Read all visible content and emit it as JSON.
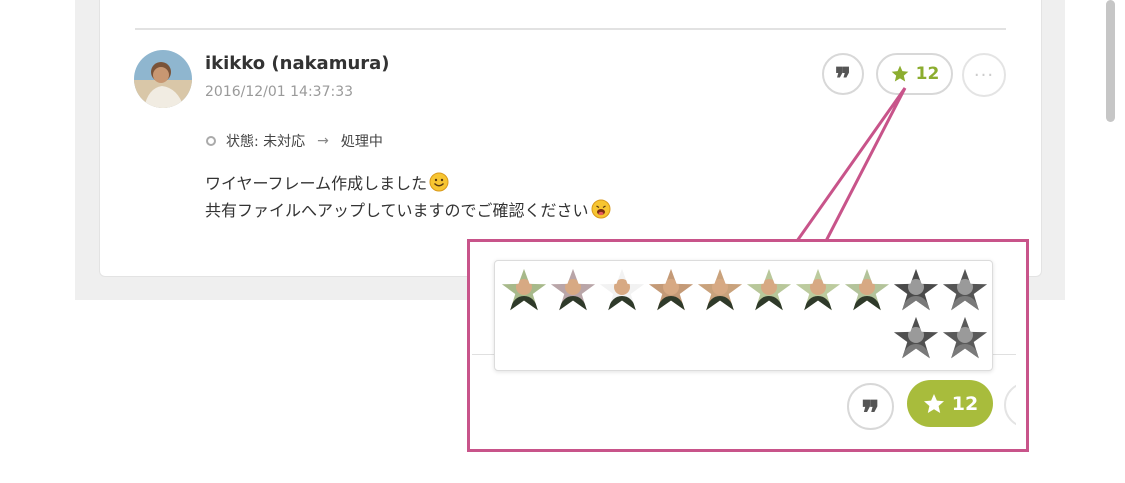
{
  "comment": {
    "author": "ikikko (nakamura)",
    "timestamp": "2016/12/01 14:37:33",
    "status": {
      "label": "状態: 未対応",
      "arrow": "→",
      "new_value": "処理中"
    },
    "message_lines": [
      "ワイヤーフレーム作成しました",
      "共有ファイルへアップしていますのでご確認ください"
    ]
  },
  "actions": {
    "quote_glyph": "❞",
    "star_count": "12",
    "more_glyph": "···"
  },
  "colors": {
    "star_green": "#8cad2f",
    "star_button_fill": "#a8bc3c",
    "callout_pink": "#c8548a"
  },
  "stargazers_count": 12
}
